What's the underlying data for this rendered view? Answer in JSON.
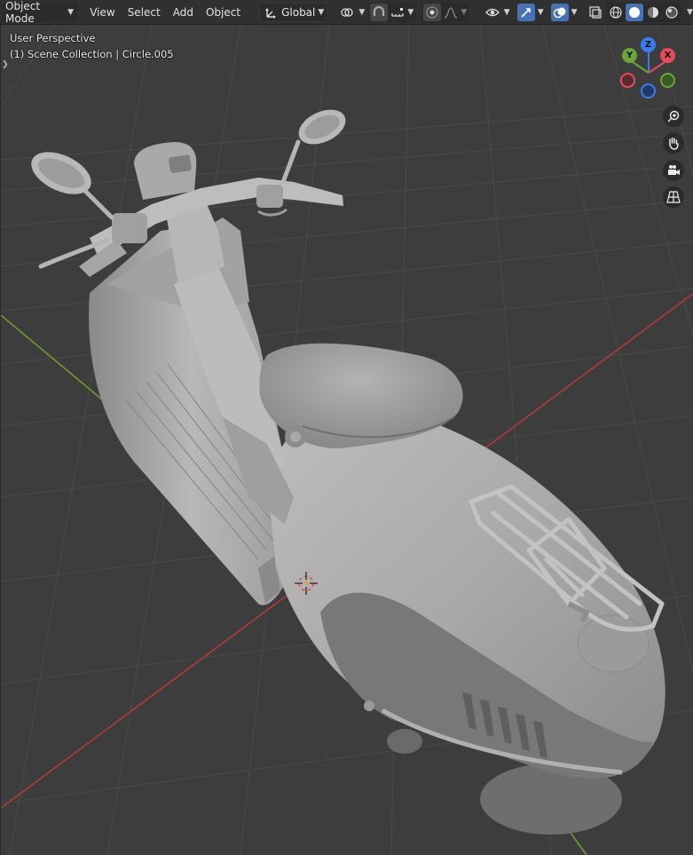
{
  "header": {
    "mode_label": "Object Mode",
    "menus": [
      "View",
      "Select",
      "Add",
      "Object"
    ],
    "transform_orientation": "Global"
  },
  "viewport": {
    "view_name": "User Perspective",
    "collection_info": "(1) Scene Collection | Circle.005"
  },
  "gizmo": {
    "axes": [
      {
        "label": "Z",
        "color": "#3b7de8"
      },
      {
        "label": "Y",
        "color": "#6aa638"
      },
      {
        "label": "X",
        "color": "#e44b5c"
      }
    ]
  },
  "colors": {
    "header_bg": "#303030",
    "viewport_bg": "#3d3d3d",
    "grid_line": "#4a4a4a",
    "x_axis_line": "#b33a3a",
    "y_axis_line": "#6f9b2a",
    "active_button": "#4772b3"
  },
  "icons": {
    "transform_orientation": "orientation-icon",
    "pivot": "pivot-icon",
    "snap": "snap-icon",
    "snap_increment": "increment-icon",
    "proportional": "proportional-edit-icon",
    "falloff": "falloff-curve-icon",
    "visibility": "eye-icon",
    "gizmo": "gizmo-icon",
    "overlays": "overlays-icon",
    "xray": "xray-icon",
    "shading": [
      "wireframe-icon",
      "solid-icon",
      "material-icon",
      "rendered-icon"
    ],
    "nav": [
      "zoom-icon",
      "hand-icon",
      "camera-icon",
      "grid-icon"
    ]
  }
}
